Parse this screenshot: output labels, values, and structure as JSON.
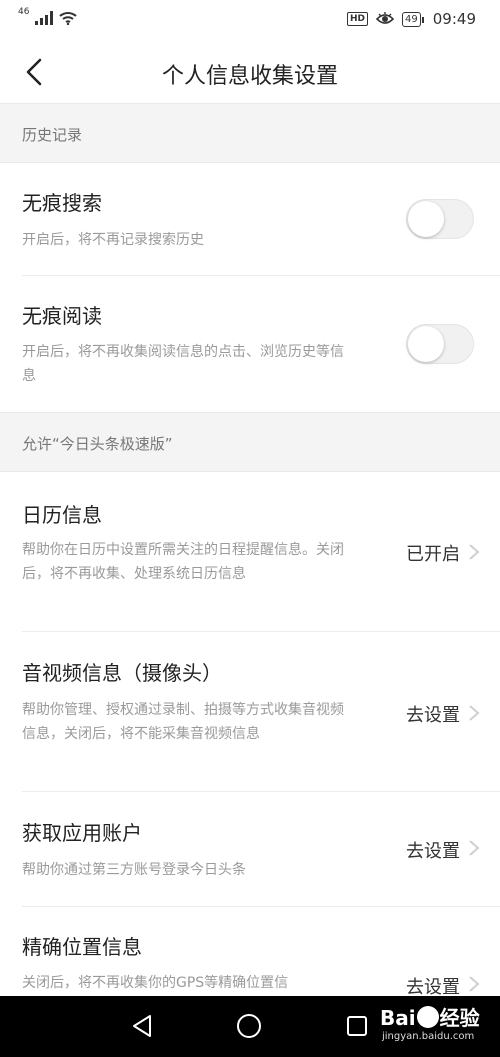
{
  "status_bar": {
    "network": "46",
    "time": "09:49",
    "battery": "49",
    "hd": "HD"
  },
  "title_bar": {
    "title": "个人信息收集设置"
  },
  "section_history": {
    "header": "历史记录"
  },
  "incognito_search": {
    "title": "无痕搜索",
    "desc": "开启后，将不再记录搜索历史",
    "enabled": false
  },
  "incognito_read": {
    "title": "无痕阅读",
    "desc": "开启后，将不再收集阅读信息的点击、浏览历史等信息",
    "enabled": false
  },
  "section_allow": {
    "header": "允许“今日头条极速版”"
  },
  "calendar": {
    "title": "日历信息",
    "desc": "帮助你在日历中设置所需关注的日程提醒信息。关闭后，将不再收集、处理系统日历信息",
    "action": "已开启"
  },
  "camera": {
    "title": "音视频信息（摄像头）",
    "desc": "帮助你管理、授权通过录制、拍摄等方式收集音视频信息，关闭后，将不能采集音视频信息",
    "action": "去设置"
  },
  "account": {
    "title": "获取应用账户",
    "desc": "帮助你通过第三方账号登录今日头条",
    "action": "去设置"
  },
  "location": {
    "title": "精确位置信息",
    "desc": "关闭后，将不再收集你的GPS等精确位置信",
    "action": "去设置"
  },
  "watermark": {
    "brand": "Bai",
    "brand2": "经验",
    "domain": "jingyan.baidu.com"
  }
}
